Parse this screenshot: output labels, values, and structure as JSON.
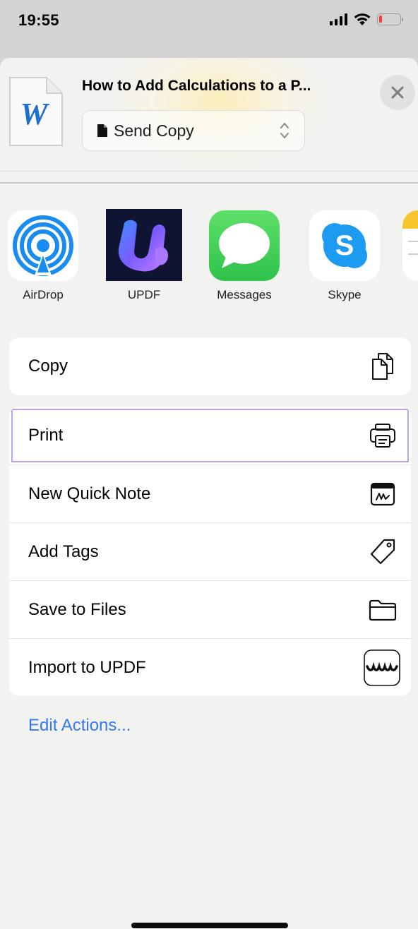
{
  "status_bar": {
    "time": "19:55"
  },
  "share_sheet": {
    "document_title": "How to Add Calculations to a P...",
    "send_option": "Send Copy",
    "doc_icon_letter": "W"
  },
  "apps": [
    {
      "label": "AirDrop",
      "icon": "airdrop-icon"
    },
    {
      "label": "UPDF",
      "icon": "updf-app-icon"
    },
    {
      "label": "Messages",
      "icon": "messages-icon"
    },
    {
      "label": "Skype",
      "icon": "skype-icon"
    }
  ],
  "actions_group_1": [
    {
      "label": "Copy",
      "icon": "copy-icon"
    }
  ],
  "actions_group_2": [
    {
      "label": "Print",
      "icon": "printer-icon"
    },
    {
      "label": "New Quick Note",
      "icon": "quick-note-icon"
    },
    {
      "label": "Add Tags",
      "icon": "tag-icon"
    },
    {
      "label": "Save to Files",
      "icon": "folder-icon"
    },
    {
      "label": "Import to UPDF",
      "icon": "updf-import-icon"
    }
  ],
  "edit_actions_label": "Edit Actions...",
  "colors": {
    "accent": "#3478f6",
    "highlight_outline": "#b9a4ea",
    "messages_green": "#2ec24b",
    "airdrop_blue": "#1a8cf0",
    "skype_blue": "#1d9bf0",
    "updf_bg": "#0f1432"
  }
}
